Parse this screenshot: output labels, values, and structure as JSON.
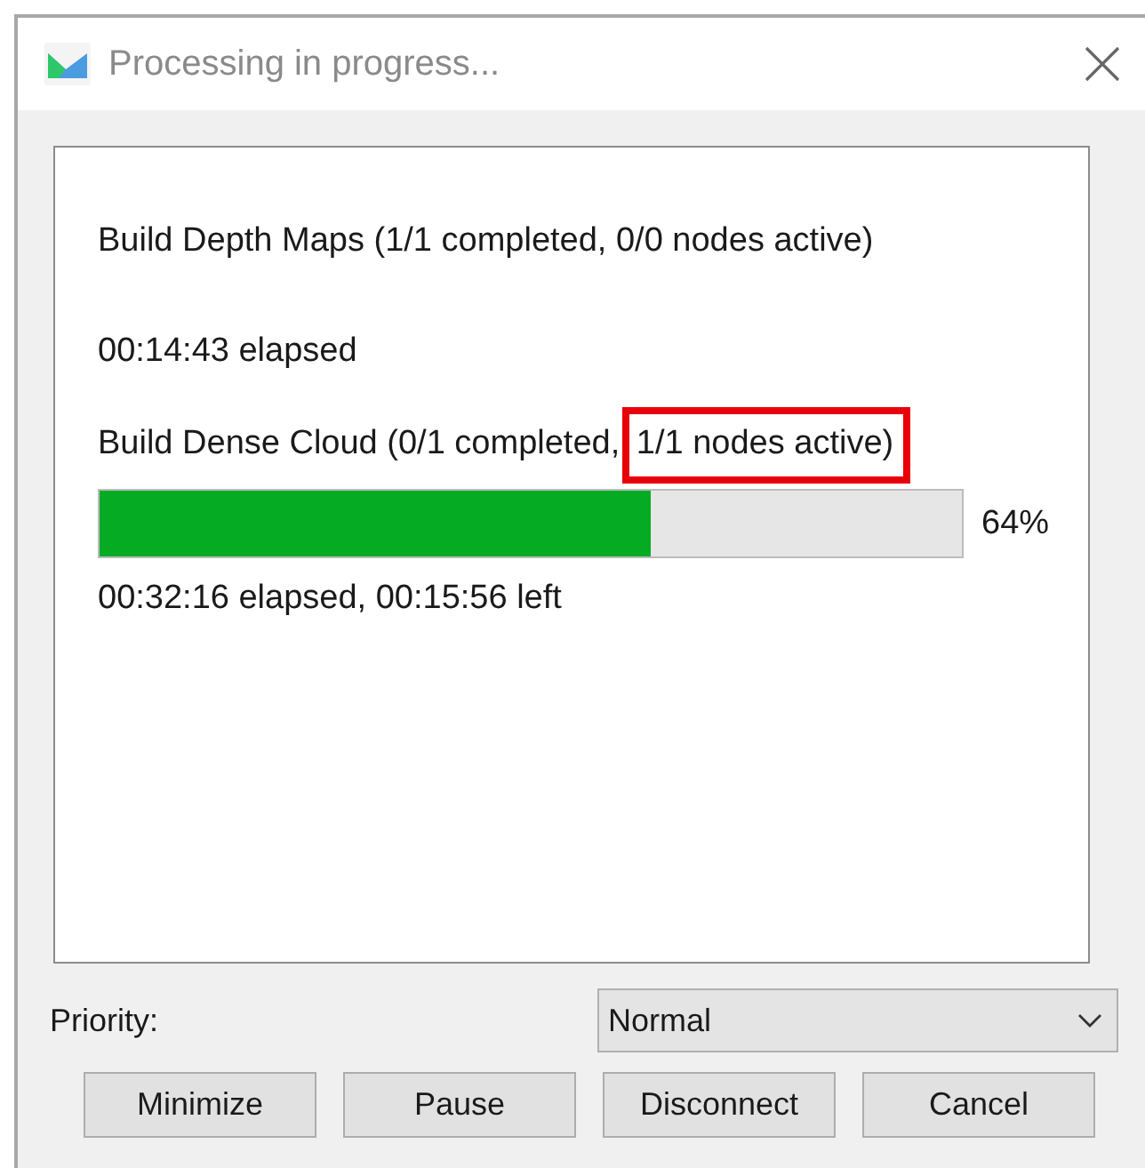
{
  "window": {
    "title": "Processing in progress..."
  },
  "tasks": [
    {
      "title": "Build Depth Maps (1/1 completed, 0/0 nodes active)",
      "time": "00:14:43 elapsed"
    },
    {
      "title": "Build Dense Cloud (0/1 completed,",
      "highlighted_text": "1/1 nodes active)",
      "progress": {
        "level": 0.64,
        "reading": "64%"
      },
      "time": "00:32:16 elapsed, 00:15:56 left"
    }
  ],
  "priority": {
    "label": "Priority:",
    "value": "Normal"
  },
  "buttons": [
    "Minimize",
    "Pause",
    "Disconnect",
    "Cancel"
  ]
}
